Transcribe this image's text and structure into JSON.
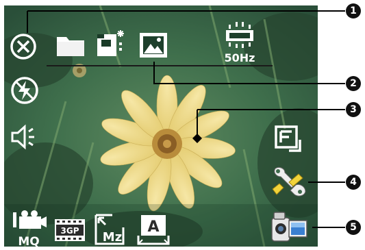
{
  "screen": {
    "image": "camera viewfinder showing a yellow flower",
    "frequency_label": "50Hz",
    "format_label": "3GP",
    "quality_label": "MQ",
    "size_label": "Mz",
    "mode_label": "A"
  },
  "callouts": [
    "1",
    "2",
    "3",
    "4",
    "5"
  ],
  "icons": {
    "top": [
      "close-icon",
      "folder-icon",
      "self-timer-icon",
      "image-icon",
      "flicker-icon"
    ],
    "left": [
      "flash-off-icon",
      "volume-icon"
    ],
    "right": [
      "frame-icon",
      "settings-icon",
      "video-camera-icon"
    ],
    "bottom": [
      "video-quality-icon",
      "format-3gp-icon",
      "video-size-icon",
      "scene-mode-icon"
    ]
  }
}
